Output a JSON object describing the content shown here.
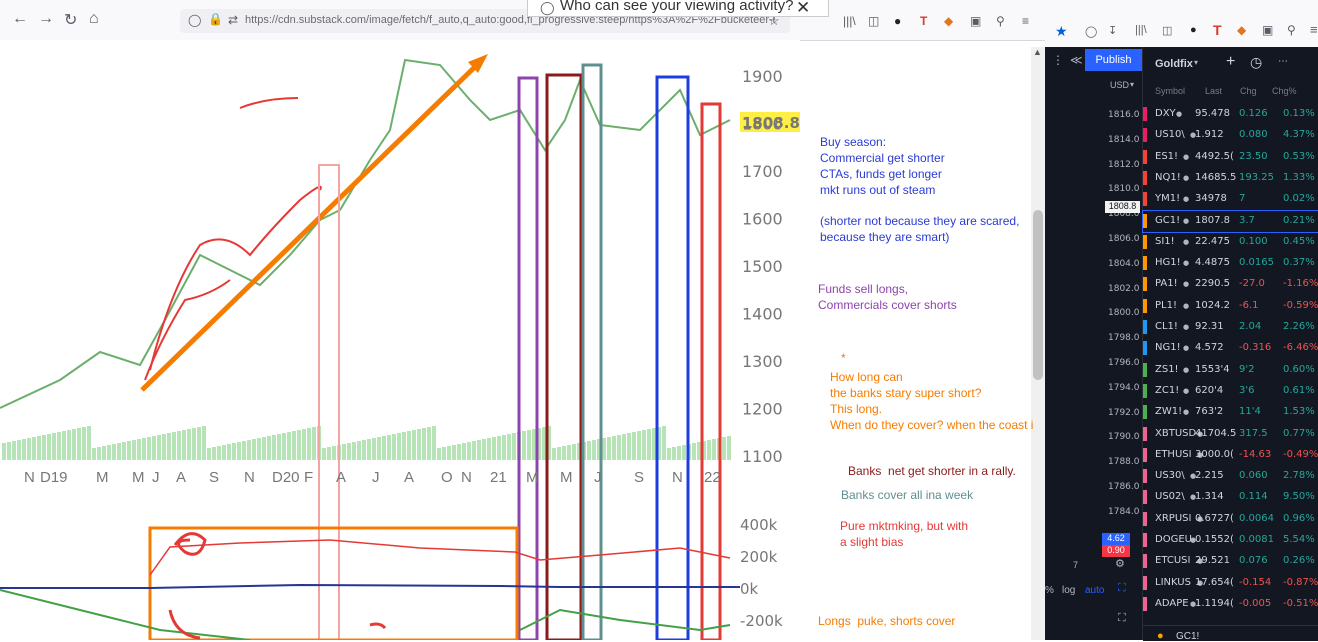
{
  "browser": {
    "url": "https://cdn.substack.com/image/fetch/f_auto,q_auto:good,fl_progressive:steep/https%3A%2F%2Fbucketeer-e05bbc8...",
    "popup_text": "Who can see your viewing activity?",
    "ext_icons": [
      "T",
      "log",
      "auto"
    ]
  },
  "chart": {
    "price_label": "1808.80",
    "y_ticks": [
      "1900",
      "1800",
      "1700",
      "1600",
      "1500",
      "1400",
      "1300",
      "1200",
      "1100"
    ],
    "x_ticks": [
      "N",
      "D19",
      "M",
      "M",
      "J",
      "A",
      "S",
      "N",
      "D20",
      "F",
      "A",
      "J",
      "A",
      "O",
      "N",
      "21",
      "M",
      "M",
      "J",
      "S",
      "N",
      "22"
    ],
    "cot_ticks": [
      "400k",
      "200k",
      "0k",
      "-200k"
    ]
  },
  "notes": {
    "buy_season": "Buy season:\nCommercial get shorter\nCTAs, funds get longer\nmkt runs out of steam",
    "shorter": "(shorter not because they are scared,\nbecause they are smart)",
    "funds_sell": "Funds sell longs,\nCommercials cover shorts",
    "how_long": "How long can\nthe banks stary super short?\nThis long.\nWhen do they cover? when the coast i",
    "banks_net": "Banks  net get shorter in a rally.",
    "banks_cover": "Banks cover all ina week",
    "pure": "Pure mktmking, but with\na slight bias",
    "longs_puke": "Longs  puke, shorts cover"
  },
  "tv": {
    "publish": "Publish",
    "watchlist_title": "Goldfix",
    "currency": "USD",
    "headers": [
      "Symbol",
      "Last",
      "Chg",
      "Chg%"
    ],
    "price_ticks": [
      "1816.0",
      "1814.0",
      "1812.0",
      "1810.0",
      "1808.0",
      "1806.0",
      "1804.0",
      "1802.0",
      "1800.0",
      "1798.0",
      "1796.0",
      "1794.0",
      "1792.0",
      "1790.0",
      "1788.0",
      "1786.0",
      "1784.0"
    ],
    "current_price": "1808.8",
    "bottom_vals": [
      "4.62",
      "0.90"
    ],
    "bottom_labels": [
      "7",
      "%",
      "log",
      "auto"
    ],
    "footer": "GC1!",
    "rows": [
      {
        "sym": "DXY",
        "last": "95.478",
        "chg": "0.126",
        "pct": "0.13%",
        "dir": "pos",
        "color": "#e91e63"
      },
      {
        "sym": "US10\\",
        "last": "1.912",
        "chg": "0.080",
        "pct": "4.37%",
        "dir": "pos",
        "color": "#e91e63"
      },
      {
        "sym": "ES1!",
        "last": "4492.5(",
        "chg": "23.50",
        "pct": "0.53%",
        "dir": "pos",
        "color": "#f44336"
      },
      {
        "sym": "NQ1!",
        "last": "14685.5",
        "chg": "193.25",
        "pct": "1.33%",
        "dir": "pos",
        "color": "#f44336"
      },
      {
        "sym": "YM1!",
        "last": "34978",
        "chg": "7",
        "pct": "0.02%",
        "dir": "pos",
        "color": "#f44336"
      },
      {
        "sym": "GC1!",
        "last": "1807.8",
        "chg": "3.7",
        "pct": "0.21%",
        "dir": "pos",
        "color": "#ff9800"
      },
      {
        "sym": "SI1!",
        "last": "22.475",
        "chg": "0.100",
        "pct": "0.45%",
        "dir": "pos",
        "color": "#ff9800"
      },
      {
        "sym": "HG1!",
        "last": "4.4875",
        "chg": "0.0165",
        "pct": "0.37%",
        "dir": "pos",
        "color": "#ff9800"
      },
      {
        "sym": "PA1!",
        "last": "2290.5",
        "chg": "-27.0",
        "pct": "-1.16%",
        "dir": "neg",
        "color": "#ff9800"
      },
      {
        "sym": "PL1!",
        "last": "1024.2",
        "chg": "-6.1",
        "pct": "-0.59%",
        "dir": "neg",
        "color": "#ff9800"
      },
      {
        "sym": "CL1!",
        "last": "92.31",
        "chg": "2.04",
        "pct": "2.26%",
        "dir": "pos",
        "color": "#2196f3"
      },
      {
        "sym": "NG1!",
        "last": "4.572",
        "chg": "-0.316",
        "pct": "-6.46%",
        "dir": "neg",
        "color": "#2196f3"
      },
      {
        "sym": "ZS1!",
        "last": "1553'4",
        "chg": "9'2",
        "pct": "0.60%",
        "dir": "pos",
        "color": "#4caf50"
      },
      {
        "sym": "ZC1!",
        "last": "620'4",
        "chg": "3'6",
        "pct": "0.61%",
        "dir": "pos",
        "color": "#4caf50"
      },
      {
        "sym": "ZW1!",
        "last": "763'2",
        "chg": "11'4",
        "pct": "1.53%",
        "dir": "pos",
        "color": "#4caf50"
      },
      {
        "sym": "XBTUSD",
        "last": "41704.5",
        "chg": "317.5",
        "pct": "0.77%",
        "dir": "pos",
        "color": "#f06292"
      },
      {
        "sym": "ETHUSI",
        "last": "3000.0(",
        "chg": "-14.63",
        "pct": "-0.49%",
        "dir": "neg",
        "color": "#f06292"
      },
      {
        "sym": "US30\\",
        "last": "2.215",
        "chg": "0.060",
        "pct": "2.78%",
        "dir": "pos",
        "color": "#f06292"
      },
      {
        "sym": "US02\\",
        "last": "1.314",
        "chg": "0.114",
        "pct": "9.50%",
        "dir": "pos",
        "color": "#f06292"
      },
      {
        "sym": "XRPUSI",
        "last": "0.6727(",
        "chg": "0.0064",
        "pct": "0.96%",
        "dir": "pos",
        "color": "#f06292"
      },
      {
        "sym": "DOGEU",
        "last": "0.1552(",
        "chg": "0.0081",
        "pct": "5.54%",
        "dir": "pos",
        "color": "#f06292"
      },
      {
        "sym": "ETCUSI",
        "last": "29.521",
        "chg": "0.076",
        "pct": "0.26%",
        "dir": "pos",
        "color": "#f06292"
      },
      {
        "sym": "LINKUS",
        "last": "17.654(",
        "chg": "-0.154",
        "pct": "-0.87%",
        "dir": "neg",
        "color": "#f06292"
      },
      {
        "sym": "ADAPE",
        "last": "1.1194(",
        "chg": "-0.005",
        "pct": "-0.51%",
        "dir": "neg",
        "color": "#f06292"
      }
    ]
  }
}
